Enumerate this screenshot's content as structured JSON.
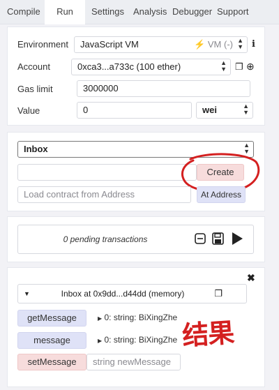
{
  "tabs": [
    "Compile",
    "Run",
    "Settings",
    "Analysis",
    "Debugger",
    "Support"
  ],
  "environment": {
    "label": "Environment",
    "value": "JavaScript VM",
    "vm_badge": "VM (-)"
  },
  "account": {
    "label": "Account",
    "value": "0xca3...a733c (100 ether)"
  },
  "gas_limit": {
    "label": "Gas limit",
    "value": "3000000"
  },
  "value": {
    "label": "Value",
    "amount": "0",
    "unit": "wei"
  },
  "contract": {
    "selected": "Inbox",
    "create_label": "Create",
    "load_placeholder": "Load contract from Address",
    "at_address_label": "At Address"
  },
  "transactions": {
    "pending_text": "0 pending transactions"
  },
  "instance": {
    "title": "Inbox at 0x9dd...d44dd (memory)",
    "functions": [
      {
        "name": "getMessage",
        "output": "0: string: BiXingZhe"
      },
      {
        "name": "message",
        "output": "0: string: BiXingZhe"
      },
      {
        "name": "setMessage",
        "placeholder": "string newMessage"
      }
    ]
  },
  "annotation": {
    "text": "结果",
    "color": "#d42020"
  }
}
